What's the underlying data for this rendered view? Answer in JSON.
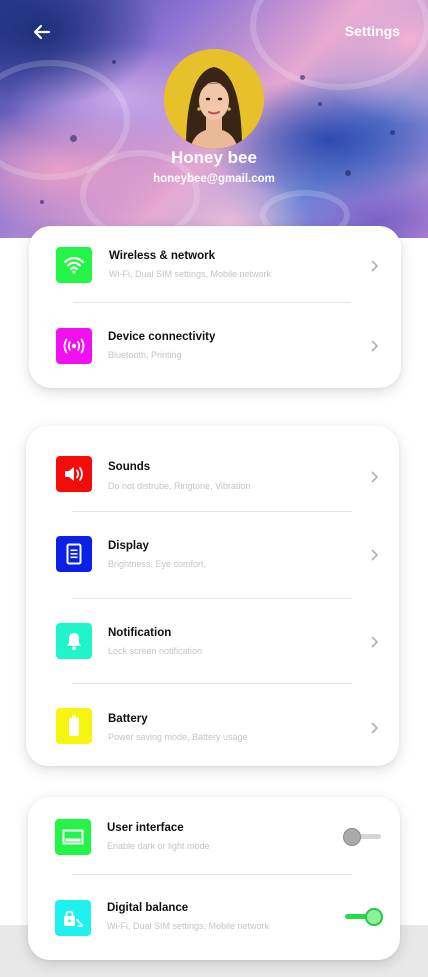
{
  "header": {
    "title": "Settings",
    "back_icon": "arrow-left-icon"
  },
  "profile": {
    "name": "Honey bee",
    "email": "honeybee@gmail.com"
  },
  "colors": {
    "wireless": "#22f548",
    "device": "#f20ff0",
    "sounds": "#f50a0a",
    "display": "#0a1fe8",
    "notification": "#20f5c9",
    "battery": "#f5f50f",
    "user_interface": "#22f548",
    "digital_balance": "#1ff0f0",
    "toggle_on": "#22dd44",
    "toggle_off": "#aaaaaa"
  },
  "group1": {
    "items": [
      {
        "title": "Wireless & network",
        "subtitle": "Wi-Fi, Dual SIM settings, Mobile network",
        "icon": "wifi-icon"
      },
      {
        "title": "Device connectivity",
        "subtitle": "Bluetooth, Printing",
        "icon": "broadcast-icon"
      }
    ]
  },
  "group2": {
    "items": [
      {
        "title": "Sounds",
        "subtitle": "Do not distrube, Ringtone, Vibration",
        "icon": "speaker-icon"
      },
      {
        "title": "Display",
        "subtitle": "Brightness, Eye comfort,",
        "icon": "display-icon"
      },
      {
        "title": "Notification",
        "subtitle": "Lock screen notification",
        "icon": "bell-icon"
      },
      {
        "title": "Battery",
        "subtitle": "Power saving mode, Battery usage",
        "icon": "battery-icon"
      }
    ]
  },
  "group3": {
    "items": [
      {
        "title": "User interface",
        "subtitle": "Enable dark or light mode",
        "icon": "screen-icon",
        "enabled": false
      },
      {
        "title": "Digital balance",
        "subtitle": "Wi-Fi, Dual SIM settings, Mobile network",
        "icon": "lock-timer-icon",
        "enabled": true
      }
    ]
  }
}
